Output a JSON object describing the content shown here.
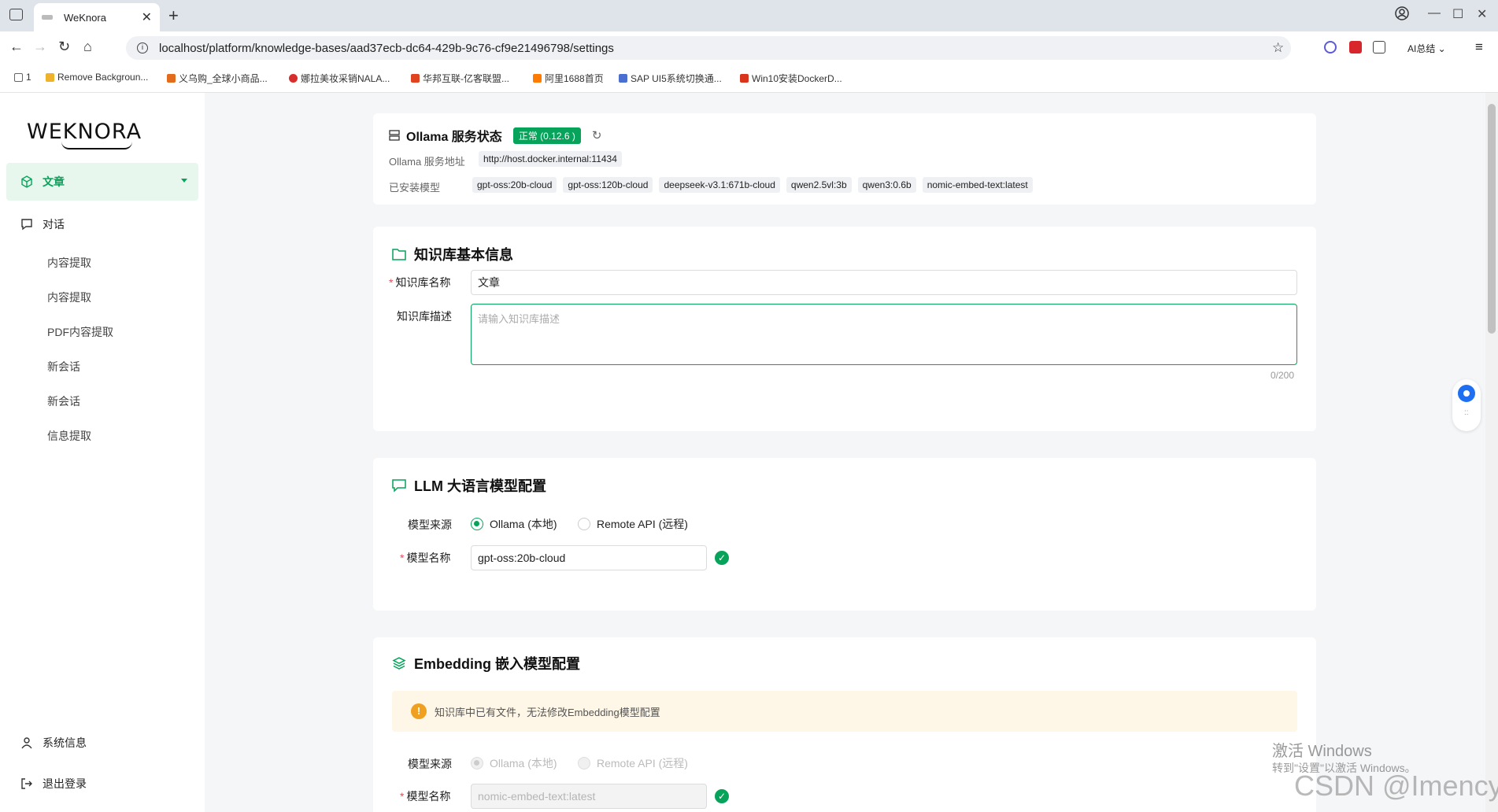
{
  "browser": {
    "tab_title": "WeKnora",
    "url": "localhost/platform/knowledge-bases/aad37ecb-dc64-429b-9c76-cf9e21496798/settings",
    "ai_summary": "AI总结",
    "bookmarks": [
      {
        "label": "1",
        "color": "#888888"
      },
      {
        "label": "Remove Backgroun...",
        "color": "#f1b22b"
      },
      {
        "label": "义乌购_全球小商品...",
        "color": "#e36b1c"
      },
      {
        "label": "娜拉美妆采销NALA...",
        "color": "#d62d2d"
      },
      {
        "label": "华邦互联-亿客联盟...",
        "color": "#e0431f"
      },
      {
        "label": "阿里1688首页",
        "color": "#ff7a00"
      },
      {
        "label": "SAP UI5系统切换通...",
        "color": "#4a6fd1"
      },
      {
        "label": "Win10安装DockerD...",
        "color": "#d9351c"
      }
    ]
  },
  "sidebar": {
    "logo": "WEKNORA",
    "active_item": "文章",
    "chat_item": "对话",
    "sub_items": [
      "内容提取",
      "内容提取",
      "PDF内容提取",
      "新会话",
      "新会话",
      "信息提取"
    ],
    "system_info": "系统信息",
    "logout": "退出登录"
  },
  "ollama": {
    "title": "Ollama 服务状态",
    "status_badge": "正常 (0.12.6 )",
    "address_label": "Ollama 服务地址",
    "address": "http://host.docker.internal:11434",
    "models_label": "已安装模型",
    "models": [
      "gpt-oss:20b-cloud",
      "gpt-oss:120b-cloud",
      "deepseek-v3.1:671b-cloud",
      "qwen2.5vl:3b",
      "qwen3:0.6b",
      "nomic-embed-text:latest"
    ]
  },
  "kb_info": {
    "title": "知识库基本信息",
    "name_label": "知识库名称",
    "name_value": "文章",
    "desc_label": "知识库描述",
    "desc_placeholder": "请输入知识库描述",
    "desc_counter": "0/200"
  },
  "llm": {
    "title": "LLM 大语言模型配置",
    "source_label": "模型来源",
    "option_local": "Ollama (本地)",
    "option_remote": "Remote API (远程)",
    "model_label": "模型名称",
    "model_value": "gpt-oss:20b-cloud"
  },
  "embedding": {
    "title": "Embedding 嵌入模型配置",
    "warning": "知识库中已有文件，无法修改Embedding模型配置",
    "source_label": "模型来源",
    "option_local": "Ollama (本地)",
    "option_remote": "Remote API (远程)",
    "model_label": "模型名称",
    "model_value": "nomic-embed-text:latest"
  },
  "watermark": {
    "activate_title": "激活 Windows",
    "activate_sub": "转到\"设置\"以激活 Windows。",
    "csdn": "CSDN @Imency"
  },
  "colors": {
    "accent": "#07a35a",
    "warning": "#f0a020",
    "required": "#e34d59"
  }
}
